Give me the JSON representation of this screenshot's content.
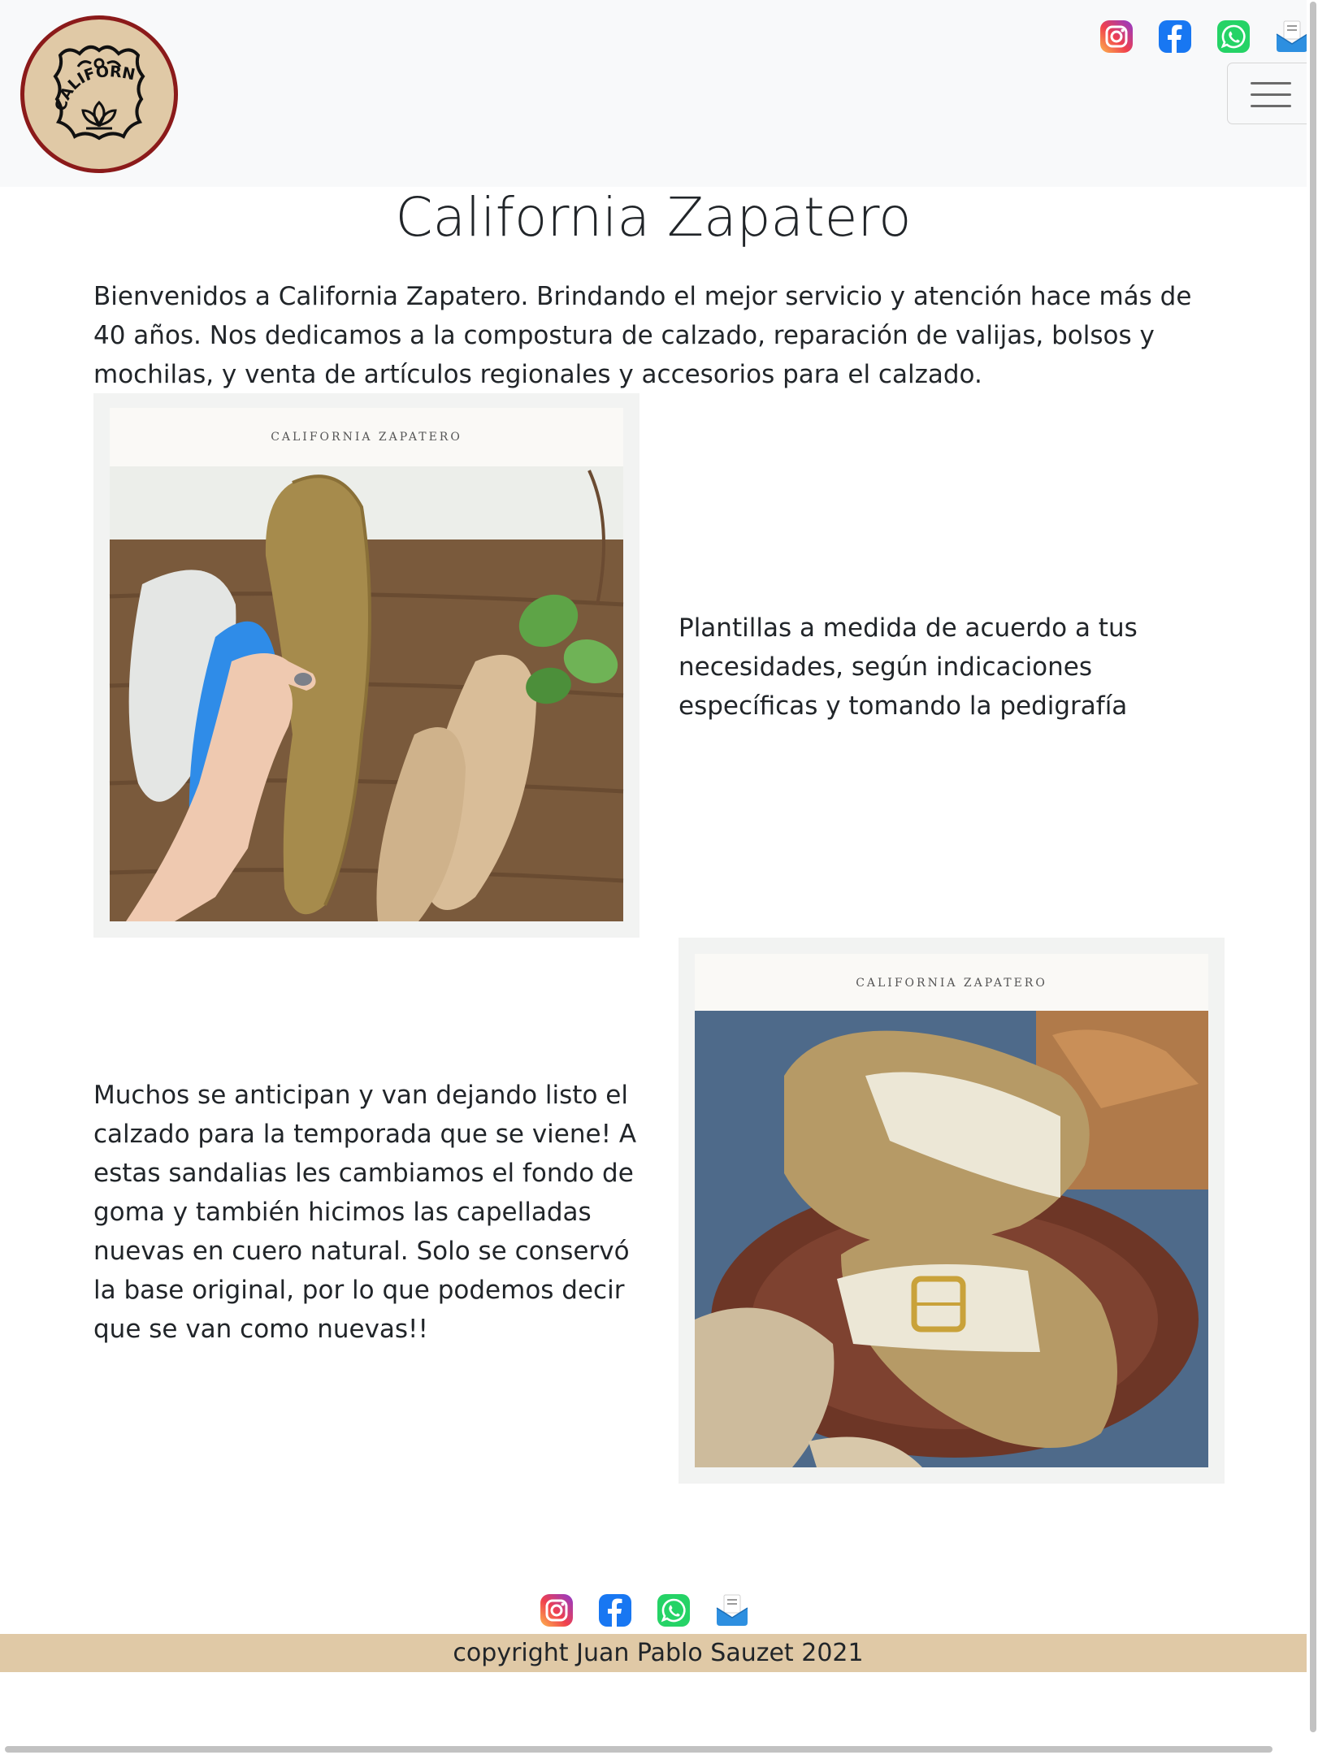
{
  "header": {
    "logo_text": "CALIFORNIA",
    "social": [
      {
        "name": "instagram-icon",
        "label": "Instagram"
      },
      {
        "name": "facebook-icon",
        "label": "Facebook"
      },
      {
        "name": "whatsapp-icon",
        "label": "WhatsApp"
      },
      {
        "name": "email-icon",
        "label": "Email"
      }
    ],
    "menu_icon": "hamburger-menu-icon"
  },
  "main": {
    "title": "California Zapatero",
    "intro": "Bienvenidos a California Zapatero. Brindando el mejor servicio y atención hace más de 40 años. Nos dedicamos a la compostura de calzado, reparación de valijas, bolsos y mochilas, y venta de artículos regionales y accesorios para el calzado.",
    "sections": [
      {
        "image_caption": "CALIFORNIA ZAPATERO",
        "text": "Plantillas a medida de acuerdo a tus necesidades, según indicaciones específicas y tomando la pedigrafía"
      },
      {
        "image_caption": "CALIFORNIA ZAPATERO",
        "text": "Muchos se anticipan y van dejando listo el calzado para la temporada que se viene! A estas sandalias les cambiamos el fondo de goma y también hicimos las capelladas nuevas en cuero natural. Solo se conservó la base original, por lo que podemos decir que se van como nuevas!!"
      }
    ]
  },
  "footer": {
    "copyright": "copyright Juan Pablo Sauzet 2021"
  },
  "colors": {
    "navbar_bg": "#f8f9fa",
    "footer_bg": "#e0c9a6",
    "logo_ring": "#8b1a1a",
    "logo_fill": "#e0c9a6"
  }
}
